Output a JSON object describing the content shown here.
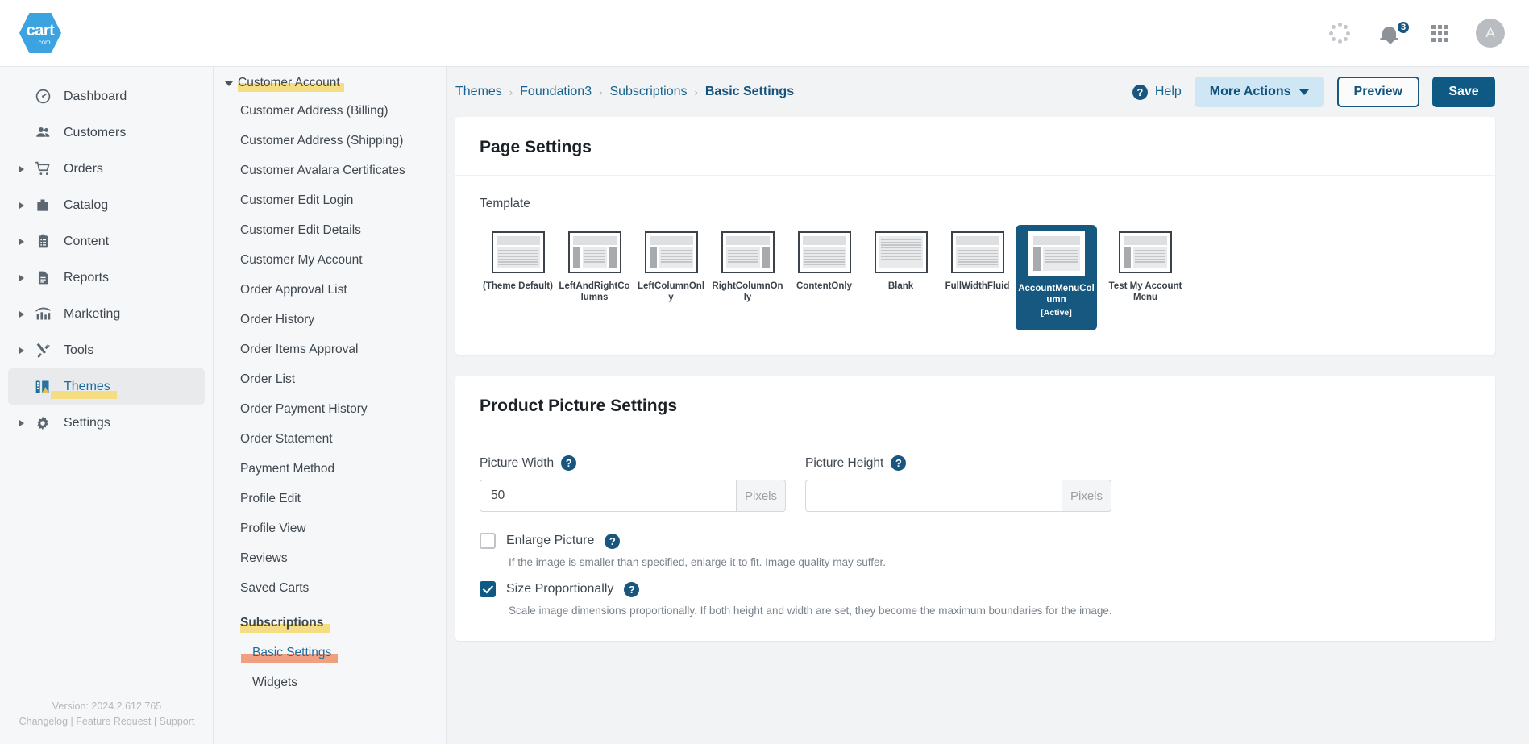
{
  "header": {
    "logo_text": "cart",
    "logo_sub": ".com",
    "icons": {
      "loading": "loading-spinner-icon",
      "notifications": "bell-icon",
      "apps": "apps-grid-icon",
      "avatar": "A"
    },
    "notification_count": "3"
  },
  "sidebar": {
    "items": [
      {
        "label": "Dashboard",
        "icon": "dashboard-icon",
        "expandable": false,
        "active": false
      },
      {
        "label": "Customers",
        "icon": "customers-icon",
        "expandable": false,
        "active": false
      },
      {
        "label": "Orders",
        "icon": "orders-cart-icon",
        "expandable": true,
        "active": false
      },
      {
        "label": "Catalog",
        "icon": "catalog-box-icon",
        "expandable": true,
        "active": false
      },
      {
        "label": "Content",
        "icon": "content-clipboard-icon",
        "expandable": true,
        "active": false
      },
      {
        "label": "Reports",
        "icon": "reports-document-icon",
        "expandable": true,
        "active": false
      },
      {
        "label": "Marketing",
        "icon": "marketing-chart-icon",
        "expandable": true,
        "active": false
      },
      {
        "label": "Tools",
        "icon": "tools-wrench-icon",
        "expandable": true,
        "active": false
      },
      {
        "label": "Themes",
        "icon": "themes-palette-icon",
        "expandable": false,
        "active": true
      },
      {
        "label": "Settings",
        "icon": "settings-gear-icon",
        "expandable": true,
        "active": false
      }
    ],
    "version": "Version: 2024.2.612.765",
    "footer_links": [
      "Changelog",
      "Feature Request",
      "Support"
    ],
    "footer_sep": "|"
  },
  "pagesnav": {
    "group": {
      "label": "Customer Account",
      "highlight": "yellow"
    },
    "items": [
      {
        "label": "Customer Address (Billing)"
      },
      {
        "label": "Customer Address (Shipping)"
      },
      {
        "label": "Customer Avalara Certificates"
      },
      {
        "label": "Customer Edit Login"
      },
      {
        "label": "Customer Edit Details"
      },
      {
        "label": "Customer My Account"
      },
      {
        "label": "Order Approval List"
      },
      {
        "label": "Order History"
      },
      {
        "label": "Order Items Approval"
      },
      {
        "label": "Order List"
      },
      {
        "label": "Order Payment History"
      },
      {
        "label": "Order Statement"
      },
      {
        "label": "Payment Method"
      },
      {
        "label": "Profile Edit"
      },
      {
        "label": "Profile View"
      },
      {
        "label": "Reviews"
      },
      {
        "label": "Saved Carts"
      }
    ],
    "subscriptions": {
      "label": "Subscriptions",
      "highlight": "yellow"
    },
    "sub_items": [
      {
        "label": "Basic Settings",
        "selected": true,
        "highlight": "orange"
      },
      {
        "label": "Widgets",
        "selected": false
      }
    ]
  },
  "toolbar": {
    "breadcrumb": [
      "Themes",
      "Foundation3",
      "Subscriptions",
      "Basic Settings"
    ],
    "separator": "›",
    "help_label": "Help",
    "help_icon": "question-mark-icon",
    "more_actions_label": "More Actions",
    "preview_label": "Preview",
    "save_label": "Save"
  },
  "page_settings": {
    "title": "Page Settings",
    "template_label": "Template",
    "templates": [
      {
        "name": "(Theme Default)",
        "layout": "content",
        "active": false
      },
      {
        "name": "LeftAndRightColumns",
        "layout": "both",
        "active": false
      },
      {
        "name": "LeftColumnOnly",
        "layout": "left",
        "active": false
      },
      {
        "name": "RightColumnOnly",
        "layout": "right",
        "active": false
      },
      {
        "name": "ContentOnly",
        "layout": "content",
        "active": false
      },
      {
        "name": "Blank",
        "layout": "blank",
        "active": false
      },
      {
        "name": "FullWidthFluid",
        "layout": "content",
        "active": false
      },
      {
        "name": "AccountMenuColumn",
        "layout": "left",
        "active": true,
        "active_tag": "[Active]"
      },
      {
        "name": "Test My Account Menu",
        "layout": "left",
        "active": false
      }
    ]
  },
  "product_picture_settings": {
    "title": "Product Picture Settings",
    "picture_width": {
      "label": "Picture Width",
      "value": "50",
      "placeholder": "",
      "suffix": "Pixels",
      "help_icon": "question-mark-icon"
    },
    "picture_height": {
      "label": "Picture Height",
      "value": "",
      "placeholder": "",
      "suffix": "Pixels",
      "help_icon": "question-mark-icon"
    },
    "enlarge_picture": {
      "label": "Enlarge Picture",
      "checked": false,
      "help_text": "If the image is smaller than specified, enlarge it to fit. Image quality may suffer."
    },
    "size_proportionally": {
      "label": "Size Proportionally",
      "checked": true,
      "help_text": "Scale image dimensions proportionally. If both height and width are set, they become the maximum boundaries for the image."
    }
  },
  "colors": {
    "brand_blue": "#0f5a85",
    "link_blue": "#19618f",
    "logo_blue": "#3aa3e0",
    "highlight_yellow": "#f5dd84",
    "highlight_orange": "#f0a080",
    "panel_bg": "#f6f7f8",
    "main_bg": "#f2f3f4"
  }
}
